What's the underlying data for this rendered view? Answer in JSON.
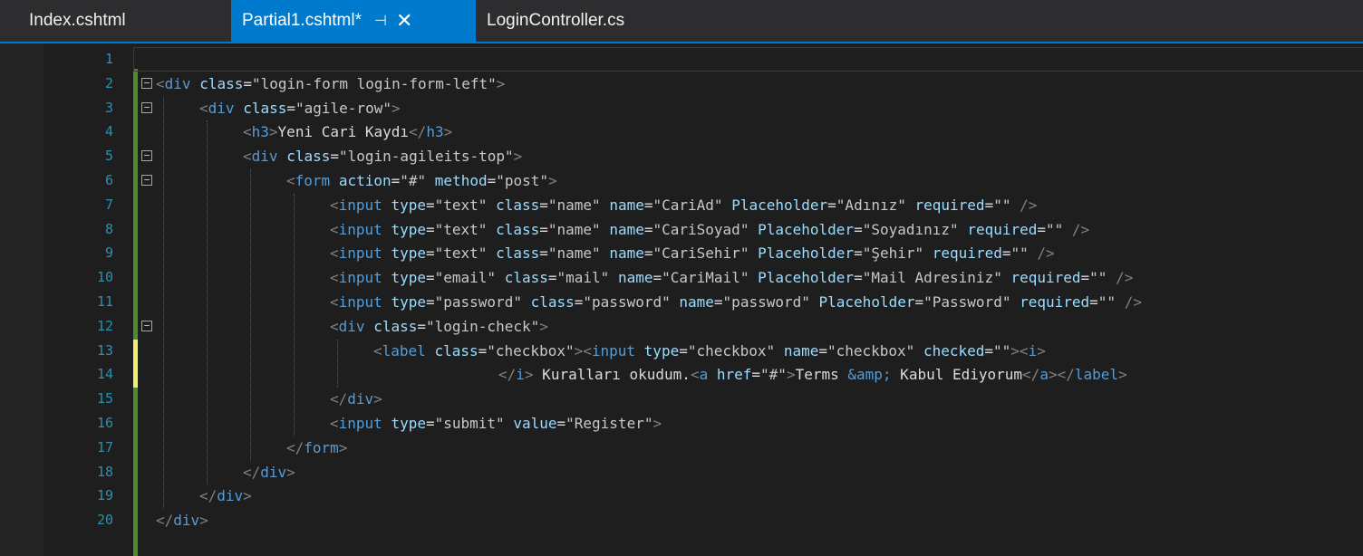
{
  "tabs": [
    {
      "label": "Index.cshtml"
    },
    {
      "label": "Partial1.cshtml*"
    },
    {
      "label": "LoginController.cs"
    }
  ],
  "lines": [
    {
      "n": "1",
      "tokens": []
    },
    {
      "n": "2",
      "tokens": [
        [
          "br",
          "<"
        ],
        [
          "tag",
          "div"
        ],
        [
          "txt",
          " "
        ],
        [
          "attr",
          "class"
        ],
        [
          "txt",
          "="
        ],
        [
          "str",
          "\"login-form login-form-left\""
        ],
        [
          "br",
          ">"
        ]
      ]
    },
    {
      "n": "3",
      "tokens": [
        [
          "br",
          "<"
        ],
        [
          "tag",
          "div"
        ],
        [
          "txt",
          " "
        ],
        [
          "attr",
          "class"
        ],
        [
          "txt",
          "="
        ],
        [
          "str",
          "\"agile-row\""
        ],
        [
          "br",
          ">"
        ]
      ]
    },
    {
      "n": "4",
      "tokens": [
        [
          "br",
          "<"
        ],
        [
          "tag",
          "h3"
        ],
        [
          "br",
          ">"
        ],
        [
          "txt",
          "Yeni Cari Kaydı"
        ],
        [
          "br",
          "</"
        ],
        [
          "tag",
          "h3"
        ],
        [
          "br",
          ">"
        ]
      ]
    },
    {
      "n": "5",
      "tokens": [
        [
          "br",
          "<"
        ],
        [
          "tag",
          "div"
        ],
        [
          "txt",
          " "
        ],
        [
          "attr",
          "class"
        ],
        [
          "txt",
          "="
        ],
        [
          "str",
          "\"login-agileits-top\""
        ],
        [
          "br",
          ">"
        ]
      ]
    },
    {
      "n": "6",
      "tokens": [
        [
          "br",
          "<"
        ],
        [
          "tag",
          "form"
        ],
        [
          "txt",
          " "
        ],
        [
          "attr",
          "action"
        ],
        [
          "txt",
          "="
        ],
        [
          "str",
          "\"#\""
        ],
        [
          "txt",
          " "
        ],
        [
          "attr",
          "method"
        ],
        [
          "txt",
          "="
        ],
        [
          "str",
          "\"post\""
        ],
        [
          "br",
          ">"
        ]
      ]
    },
    {
      "n": "7",
      "tokens": [
        [
          "br",
          "<"
        ],
        [
          "tag",
          "input"
        ],
        [
          "txt",
          " "
        ],
        [
          "attr",
          "type"
        ],
        [
          "txt",
          "="
        ],
        [
          "str",
          "\"text\""
        ],
        [
          "txt",
          " "
        ],
        [
          "attr",
          "class"
        ],
        [
          "txt",
          "="
        ],
        [
          "str",
          "\"name\""
        ],
        [
          "txt",
          " "
        ],
        [
          "attr",
          "name"
        ],
        [
          "txt",
          "="
        ],
        [
          "str",
          "\"CariAd\""
        ],
        [
          "txt",
          " "
        ],
        [
          "attr",
          "Placeholder"
        ],
        [
          "txt",
          "="
        ],
        [
          "str",
          "\"Adınız\""
        ],
        [
          "txt",
          " "
        ],
        [
          "attr",
          "required"
        ],
        [
          "txt",
          "="
        ],
        [
          "str",
          "\"\""
        ],
        [
          "txt",
          " "
        ],
        [
          "br",
          "/>"
        ]
      ]
    },
    {
      "n": "8",
      "tokens": [
        [
          "br",
          "<"
        ],
        [
          "tag",
          "input"
        ],
        [
          "txt",
          " "
        ],
        [
          "attr",
          "type"
        ],
        [
          "txt",
          "="
        ],
        [
          "str",
          "\"text\""
        ],
        [
          "txt",
          " "
        ],
        [
          "attr",
          "class"
        ],
        [
          "txt",
          "="
        ],
        [
          "str",
          "\"name\""
        ],
        [
          "txt",
          " "
        ],
        [
          "attr",
          "name"
        ],
        [
          "txt",
          "="
        ],
        [
          "str",
          "\"CariSoyad\""
        ],
        [
          "txt",
          " "
        ],
        [
          "attr",
          "Placeholder"
        ],
        [
          "txt",
          "="
        ],
        [
          "str",
          "\"Soyadınız\""
        ],
        [
          "txt",
          " "
        ],
        [
          "attr",
          "required"
        ],
        [
          "txt",
          "="
        ],
        [
          "str",
          "\"\""
        ],
        [
          "txt",
          " "
        ],
        [
          "br",
          "/>"
        ]
      ]
    },
    {
      "n": "9",
      "tokens": [
        [
          "br",
          "<"
        ],
        [
          "tag",
          "input"
        ],
        [
          "txt",
          " "
        ],
        [
          "attr",
          "type"
        ],
        [
          "txt",
          "="
        ],
        [
          "str",
          "\"text\""
        ],
        [
          "txt",
          " "
        ],
        [
          "attr",
          "class"
        ],
        [
          "txt",
          "="
        ],
        [
          "str",
          "\"name\""
        ],
        [
          "txt",
          " "
        ],
        [
          "attr",
          "name"
        ],
        [
          "txt",
          "="
        ],
        [
          "str",
          "\"CariSehir\""
        ],
        [
          "txt",
          " "
        ],
        [
          "attr",
          "Placeholder"
        ],
        [
          "txt",
          "="
        ],
        [
          "str",
          "\"Şehir\""
        ],
        [
          "txt",
          " "
        ],
        [
          "attr",
          "required"
        ],
        [
          "txt",
          "="
        ],
        [
          "str",
          "\"\""
        ],
        [
          "txt",
          " "
        ],
        [
          "br",
          "/>"
        ]
      ]
    },
    {
      "n": "10",
      "tokens": [
        [
          "br",
          "<"
        ],
        [
          "tag",
          "input"
        ],
        [
          "txt",
          " "
        ],
        [
          "attr",
          "type"
        ],
        [
          "txt",
          "="
        ],
        [
          "str",
          "\"email\""
        ],
        [
          "txt",
          " "
        ],
        [
          "attr",
          "class"
        ],
        [
          "txt",
          "="
        ],
        [
          "str",
          "\"mail\""
        ],
        [
          "txt",
          " "
        ],
        [
          "attr",
          "name"
        ],
        [
          "txt",
          "="
        ],
        [
          "str",
          "\"CariMail\""
        ],
        [
          "txt",
          " "
        ],
        [
          "attr",
          "Placeholder"
        ],
        [
          "txt",
          "="
        ],
        [
          "str",
          "\"Mail Adresiniz\""
        ],
        [
          "txt",
          " "
        ],
        [
          "attr",
          "required"
        ],
        [
          "txt",
          "="
        ],
        [
          "str",
          "\"\""
        ],
        [
          "txt",
          " "
        ],
        [
          "br",
          "/>"
        ]
      ]
    },
    {
      "n": "11",
      "tokens": [
        [
          "br",
          "<"
        ],
        [
          "tag",
          "input"
        ],
        [
          "txt",
          " "
        ],
        [
          "attr",
          "type"
        ],
        [
          "txt",
          "="
        ],
        [
          "str",
          "\"password\""
        ],
        [
          "txt",
          " "
        ],
        [
          "attr",
          "class"
        ],
        [
          "txt",
          "="
        ],
        [
          "str",
          "\"password\""
        ],
        [
          "txt",
          " "
        ],
        [
          "attr",
          "name"
        ],
        [
          "txt",
          "="
        ],
        [
          "str",
          "\"password\""
        ],
        [
          "txt",
          " "
        ],
        [
          "attr",
          "Placeholder"
        ],
        [
          "txt",
          "="
        ],
        [
          "str",
          "\"Password\""
        ],
        [
          "txt",
          " "
        ],
        [
          "attr",
          "required"
        ],
        [
          "txt",
          "="
        ],
        [
          "str",
          "\"\""
        ],
        [
          "txt",
          " "
        ],
        [
          "br",
          "/>"
        ]
      ]
    },
    {
      "n": "12",
      "tokens": [
        [
          "br",
          "<"
        ],
        [
          "tag",
          "div"
        ],
        [
          "txt",
          " "
        ],
        [
          "attr",
          "class"
        ],
        [
          "txt",
          "="
        ],
        [
          "str",
          "\"login-check\""
        ],
        [
          "br",
          ">"
        ]
      ]
    },
    {
      "n": "13",
      "tokens": [
        [
          "br",
          "<"
        ],
        [
          "tag",
          "label"
        ],
        [
          "txt",
          " "
        ],
        [
          "attr",
          "class"
        ],
        [
          "txt",
          "="
        ],
        [
          "str",
          "\"checkbox\""
        ],
        [
          "br",
          "><"
        ],
        [
          "tag",
          "input"
        ],
        [
          "txt",
          " "
        ],
        [
          "attr",
          "type"
        ],
        [
          "txt",
          "="
        ],
        [
          "str",
          "\"checkbox\""
        ],
        [
          "txt",
          " "
        ],
        [
          "attr",
          "name"
        ],
        [
          "txt",
          "="
        ],
        [
          "str",
          "\"checkbox\""
        ],
        [
          "txt",
          " "
        ],
        [
          "attr",
          "checked"
        ],
        [
          "txt",
          "="
        ],
        [
          "str",
          "\"\""
        ],
        [
          "br",
          "><"
        ],
        [
          "tag",
          "i"
        ],
        [
          "br",
          ">"
        ]
      ]
    },
    {
      "n": "14",
      "tokens": [
        [
          "br",
          "</"
        ],
        [
          "tag",
          "i"
        ],
        [
          "br",
          ">"
        ],
        [
          "txt",
          " Kuralları okudum."
        ],
        [
          "br",
          "<"
        ],
        [
          "tag",
          "a"
        ],
        [
          "txt",
          " "
        ],
        [
          "attr",
          "href"
        ],
        [
          "txt",
          "="
        ],
        [
          "str",
          "\"#\""
        ],
        [
          "br",
          ">"
        ],
        [
          "txt",
          "Terms "
        ],
        [
          "ent",
          "&amp;"
        ],
        [
          "txt",
          " Kabul Ediyorum"
        ],
        [
          "br",
          "</"
        ],
        [
          "tag",
          "a"
        ],
        [
          "br",
          "></"
        ],
        [
          "tag",
          "label"
        ],
        [
          "br",
          ">"
        ]
      ]
    },
    {
      "n": "15",
      "tokens": [
        [
          "br",
          "</"
        ],
        [
          "tag",
          "div"
        ],
        [
          "br",
          ">"
        ]
      ]
    },
    {
      "n": "16",
      "tokens": [
        [
          "br",
          "<"
        ],
        [
          "tag",
          "input"
        ],
        [
          "txt",
          " "
        ],
        [
          "attr",
          "type"
        ],
        [
          "txt",
          "="
        ],
        [
          "str",
          "\"submit\""
        ],
        [
          "txt",
          " "
        ],
        [
          "attr",
          "value"
        ],
        [
          "txt",
          "="
        ],
        [
          "str",
          "\"Register\""
        ],
        [
          "br",
          ">"
        ]
      ]
    },
    {
      "n": "17",
      "tokens": [
        [
          "br",
          "</"
        ],
        [
          "tag",
          "form"
        ],
        [
          "br",
          ">"
        ]
      ]
    },
    {
      "n": "18",
      "tokens": [
        [
          "br",
          "</"
        ],
        [
          "tag",
          "div"
        ],
        [
          "br",
          ">"
        ]
      ]
    },
    {
      "n": "19",
      "tokens": [
        [
          "br",
          "</"
        ],
        [
          "tag",
          "div"
        ],
        [
          "br",
          ">"
        ]
      ]
    },
    {
      "n": "20",
      "tokens": [
        [
          "br",
          "</"
        ],
        [
          "tag",
          "div"
        ],
        [
          "br",
          ">"
        ]
      ]
    }
  ]
}
